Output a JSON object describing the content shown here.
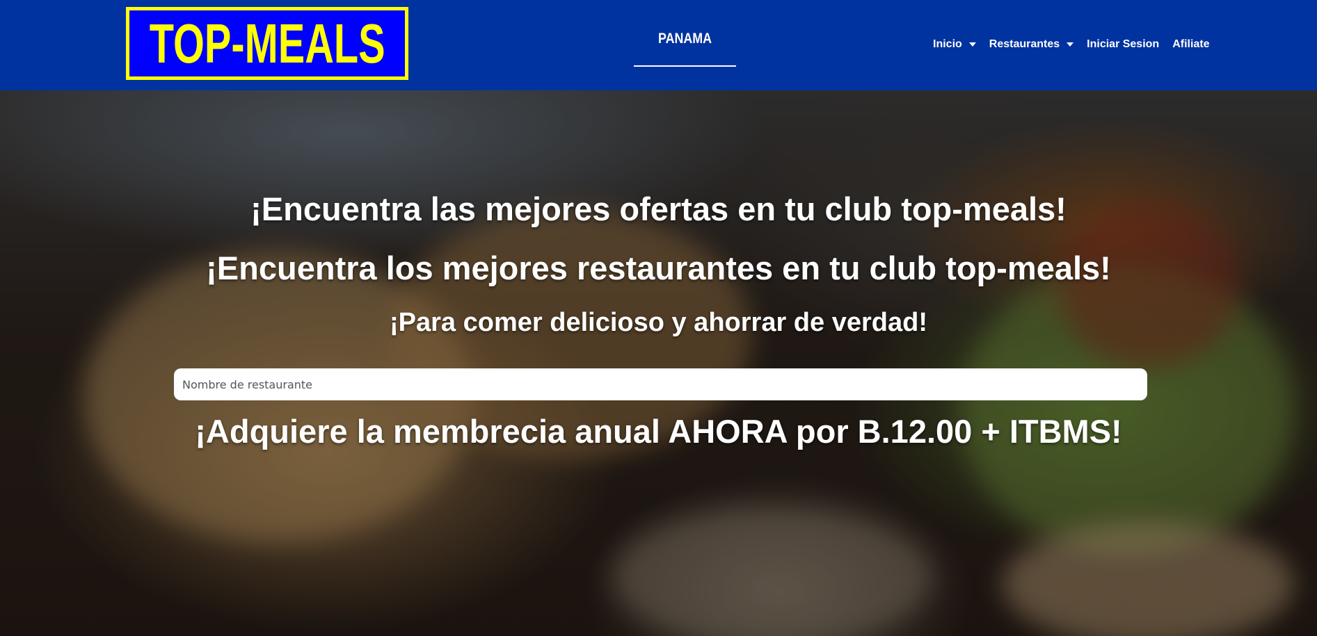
{
  "header": {
    "logo_text": "TOP-MEALS",
    "country": "PANAMA",
    "nav": [
      {
        "label": "Inicio",
        "has_dropdown": true
      },
      {
        "label": "Restaurantes",
        "has_dropdown": true
      },
      {
        "label": "Iniciar Sesion",
        "has_dropdown": false
      },
      {
        "label": "Afiliate",
        "has_dropdown": false
      }
    ],
    "colors": {
      "bar": "#0033a0",
      "logo_bg": "#0000ff",
      "logo_text": "#ffff00"
    }
  },
  "hero": {
    "line1": "¡Encuentra las mejores ofertas en tu club top-meals!",
    "line2": "¡Encuentra los mejores restaurantes en tu club top-meals!",
    "line3": "¡Para comer delicioso y ahorrar de verdad!",
    "search_placeholder": "Nombre de restaurante",
    "membership": "¡Adquiere la membrecia anual AHORA por B.12.00 + ITBMS!"
  }
}
